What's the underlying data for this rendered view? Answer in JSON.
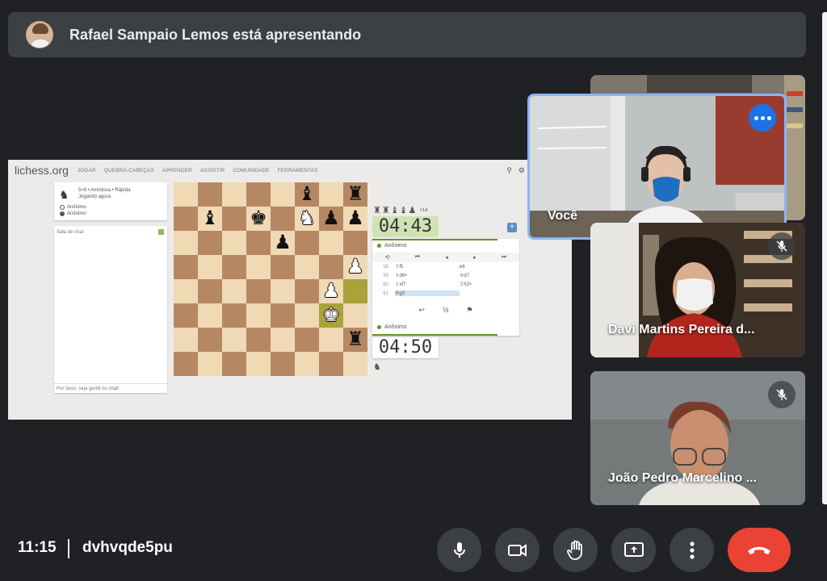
{
  "banner": {
    "presenter_text": "Rafael Sampaio Lemos está apresentando"
  },
  "shared_screen": {
    "logo": "lichess.org",
    "nav": [
      "JOGAR",
      "QUEBRA-CABEÇAS",
      "APRENDER",
      "ASSISTIR",
      "COMUNIDADE",
      "FERRAMENTAS"
    ],
    "game_info": {
      "line1": "5+8 • Amistosa • Rápida",
      "line2": "Jogando agora",
      "players": [
        "Anônimo",
        "Anônimo"
      ]
    },
    "chat": {
      "title": "Sala de chat",
      "placeholder": "Por favor, seja gentil no chat!"
    },
    "captured_plus": "+14",
    "clock_top": "04:43",
    "clock_bottom": "04:50",
    "player_top": "Anônimo",
    "player_bottom": "Anônimo",
    "moves": [
      {
        "n": "58",
        "w": "♗f5",
        "b": "e6"
      },
      {
        "n": "59",
        "w": "♗d6+",
        "b": "♔d7"
      },
      {
        "n": "60",
        "w": "♗xf7",
        "b": "♖h2+"
      },
      {
        "n": "61",
        "w": "♔g3",
        "b": ""
      }
    ],
    "draw_label": "½"
  },
  "tiles": {
    "you": {
      "name": "Você"
    },
    "davi": {
      "name": "Davi Martins Pereira d..."
    },
    "joao": {
      "name": "João Pedro Marcelino ..."
    }
  },
  "bottom_bar": {
    "time": "11:15",
    "meeting_code": "dvhvqde5pu"
  },
  "colors": {
    "background": "#202124",
    "banner": "#3c4043",
    "accent_blue": "#1a73e8",
    "end_call_red": "#ea4335",
    "active_border": "#8ab4f8"
  }
}
